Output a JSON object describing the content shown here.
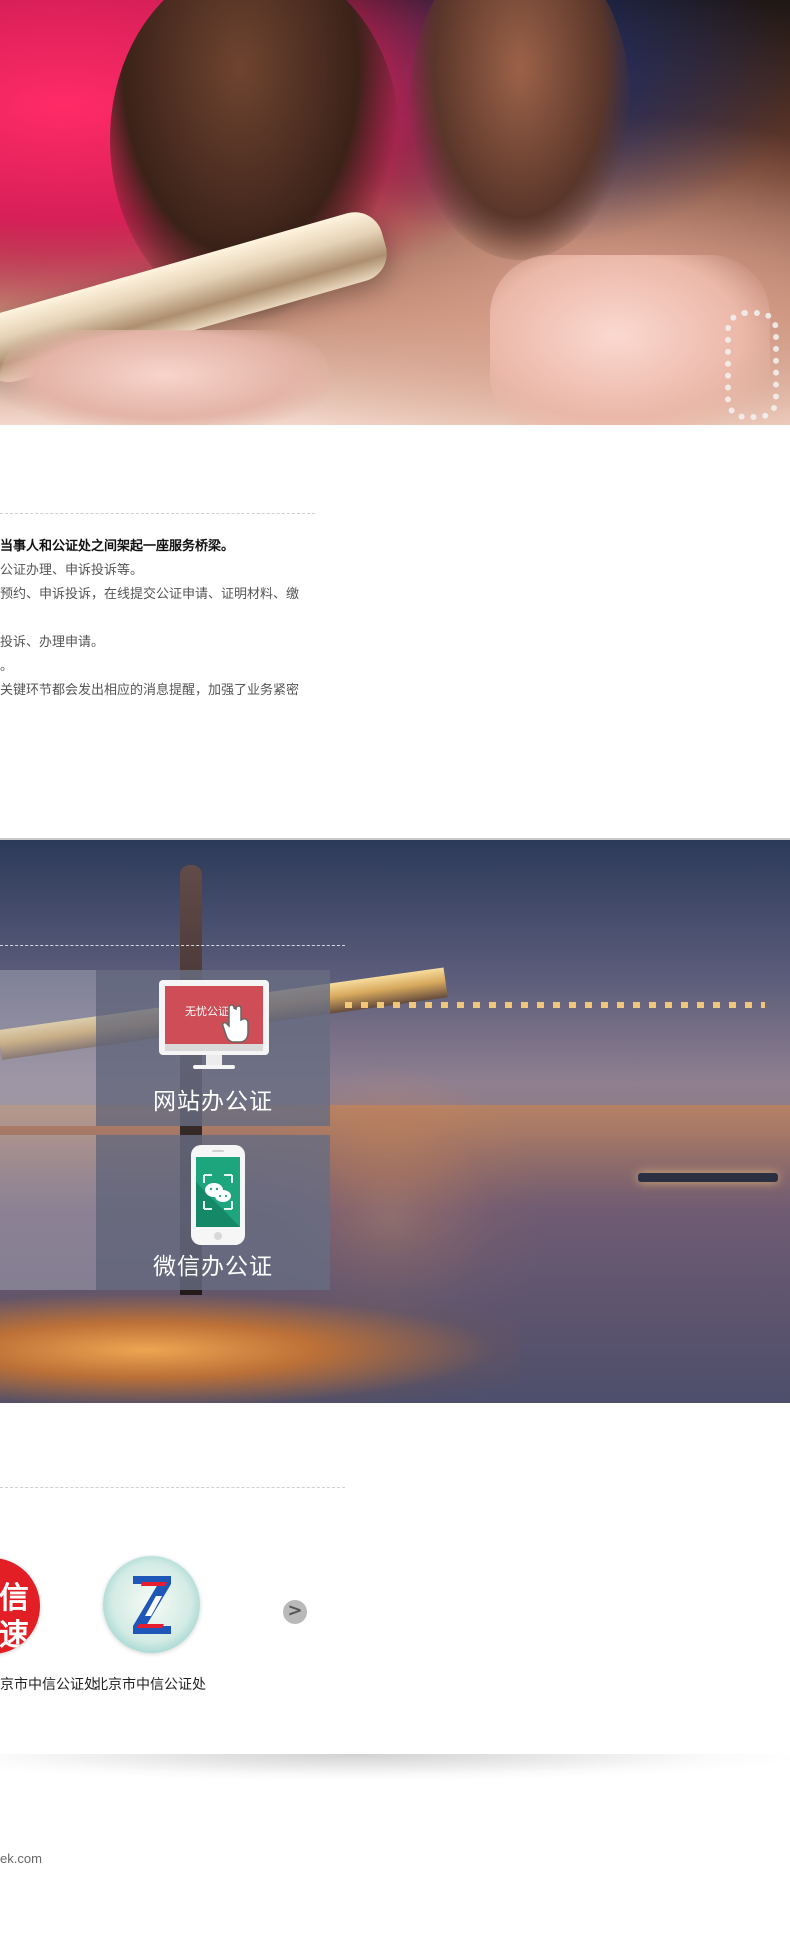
{
  "intro": {
    "lines": [
      "当事人和公证处之间架起一座服务桥梁。",
      "公证办理、申诉投诉等。",
      "预约、申诉投诉，在线提交公证申请、证明材料、缴",
      "投诉、办理申请。",
      "。",
      "关键环节都会发出相应的消息提醒，加强了业务紧密"
    ]
  },
  "services": {
    "website": {
      "label": "网站办公证",
      "icon_text": "无忧公证"
    },
    "wechat": {
      "label": "微信办公证"
    }
  },
  "partners": {
    "left_logo_text": "信\n速",
    "items": [
      {
        "name": "京市中信公证处"
      },
      {
        "name": "北京市中信公证处"
      }
    ],
    "next_label": ">"
  },
  "footer": {
    "domain": "ek.com"
  },
  "colors": {
    "white": "#ffffff",
    "intro_text": "#555555",
    "service_overlay": "#686c81",
    "partner_red": "#e31f26"
  },
  "icons": {
    "monitor": "monitor-icon",
    "pointer": "hand-pointer-icon",
    "phone": "phone-icon",
    "wechat": "wechat-icon",
    "next": "chevron-right-icon"
  }
}
